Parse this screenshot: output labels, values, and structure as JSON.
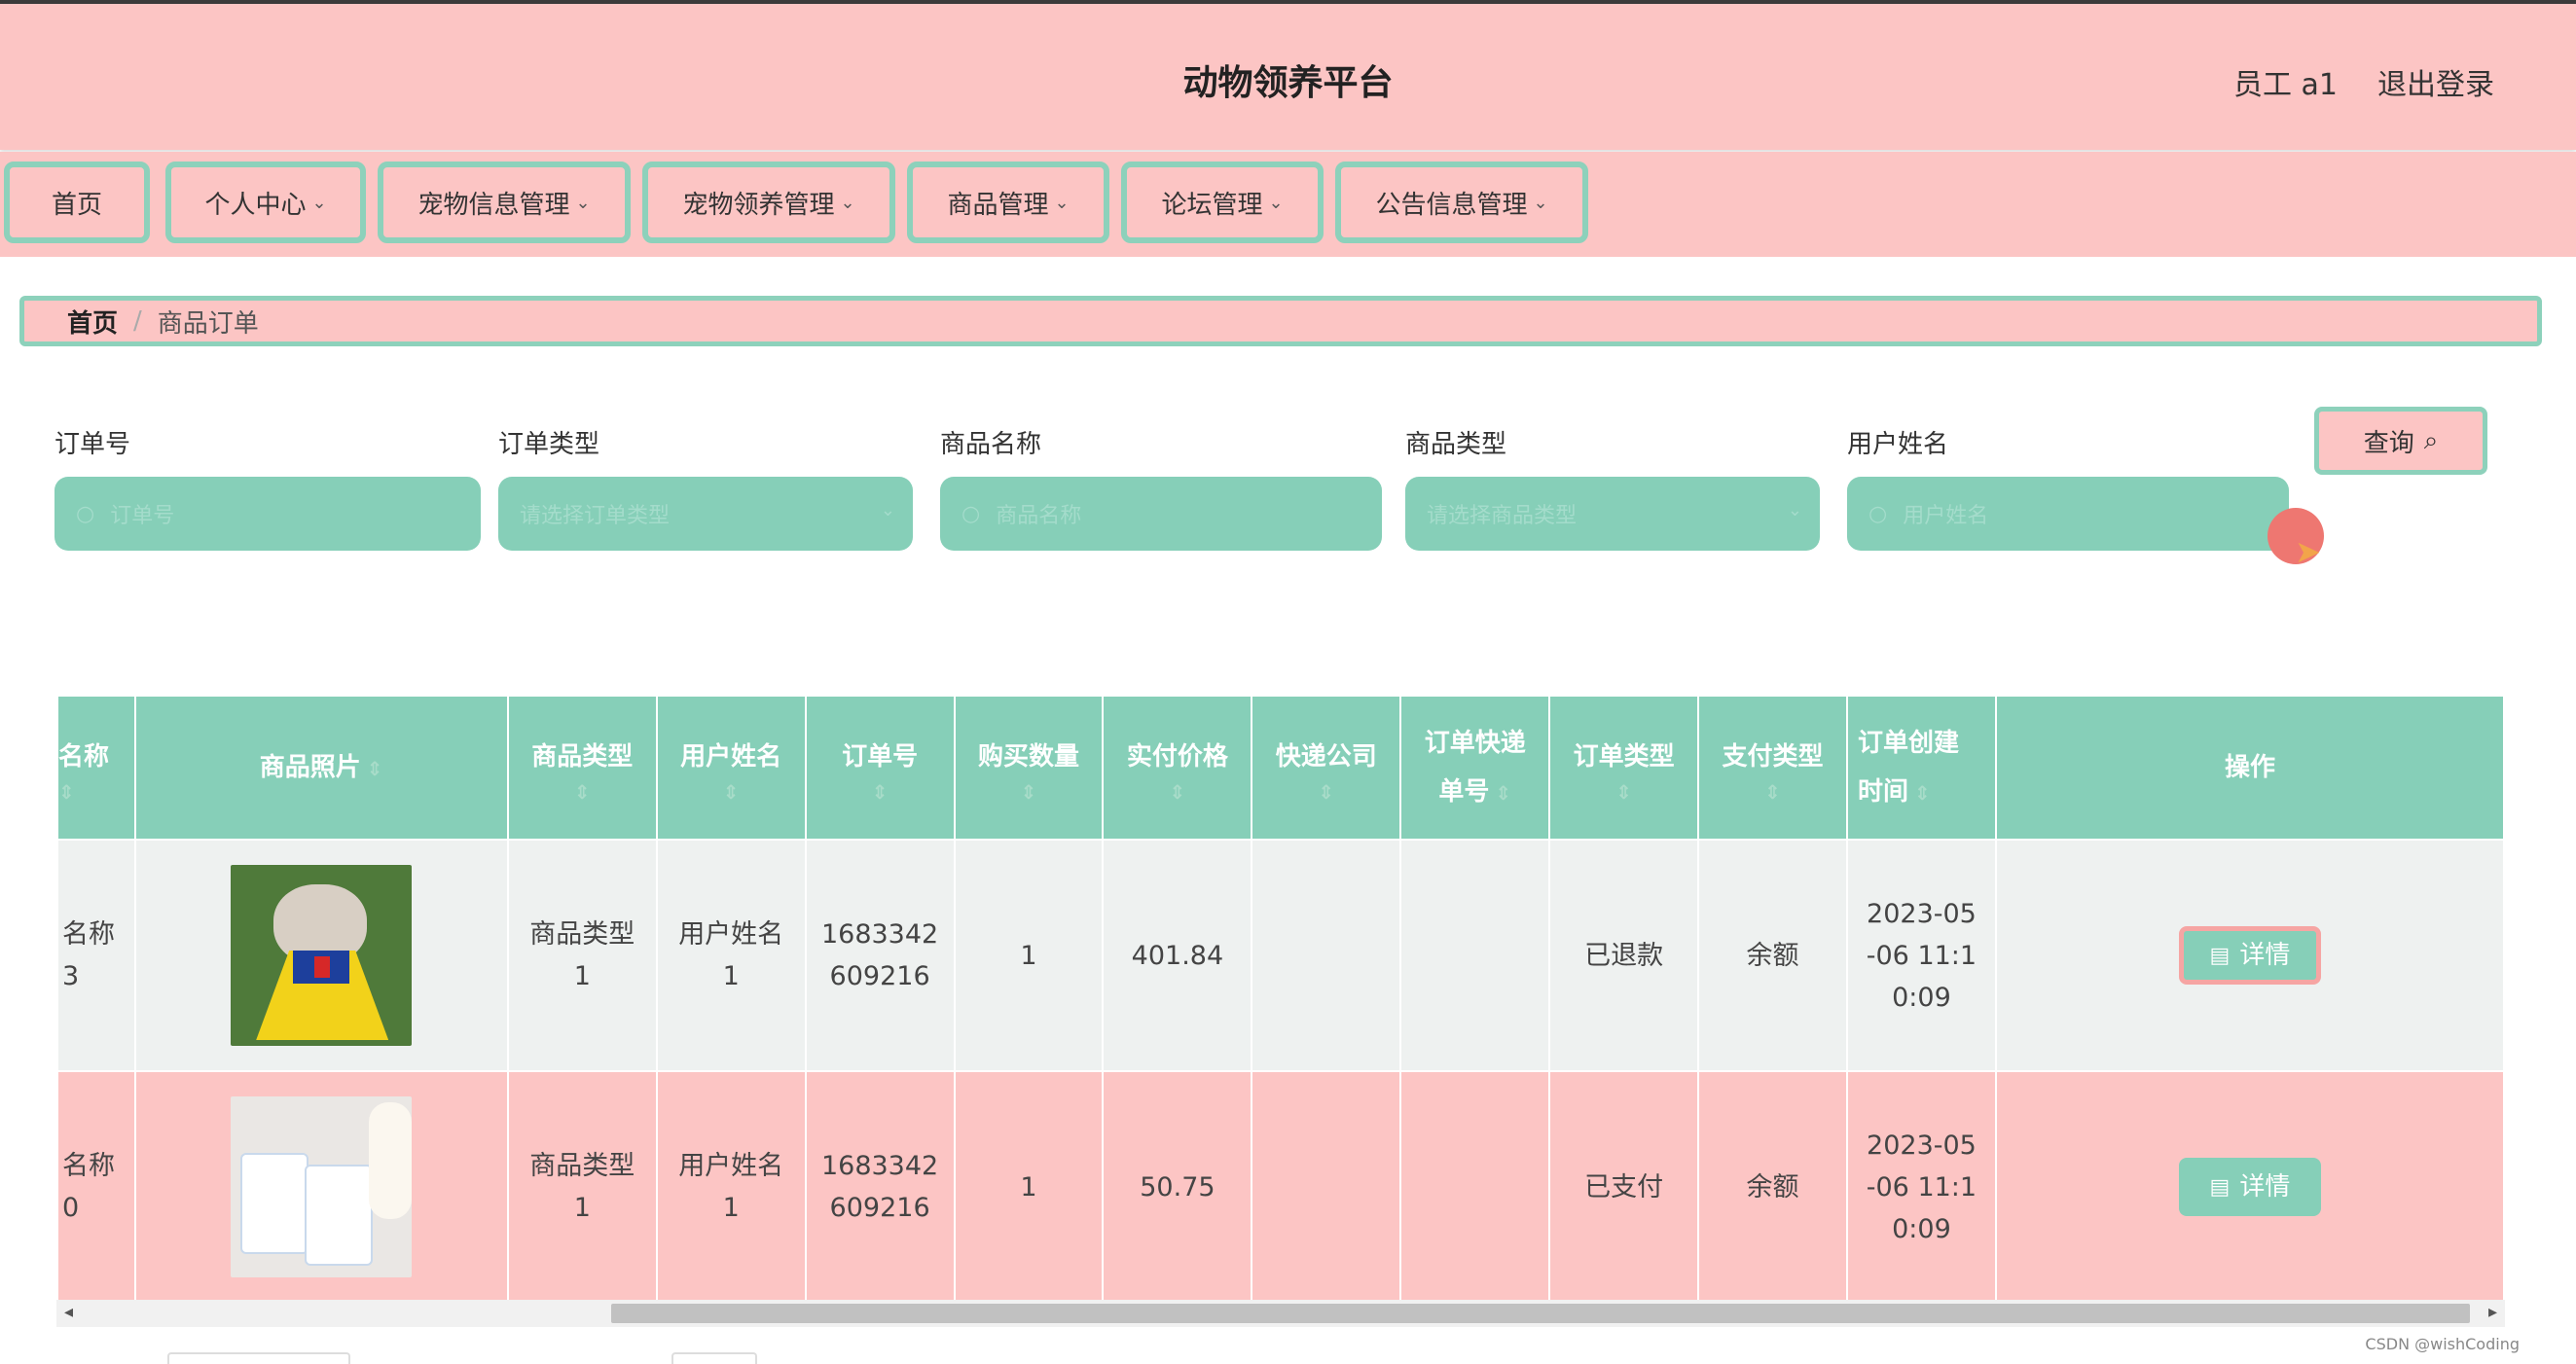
{
  "header": {
    "title": "动物领养平台",
    "user": "员工 a1",
    "logout": "退出登录"
  },
  "nav": {
    "items": [
      {
        "label": "首页",
        "has_dropdown": false
      },
      {
        "label": "个人中心",
        "has_dropdown": true
      },
      {
        "label": "宠物信息管理",
        "has_dropdown": true
      },
      {
        "label": "宠物领养管理",
        "has_dropdown": true
      },
      {
        "label": "商品管理",
        "has_dropdown": true
      },
      {
        "label": "论坛管理",
        "has_dropdown": true
      },
      {
        "label": "公告信息管理",
        "has_dropdown": true
      }
    ]
  },
  "breadcrumb": {
    "home": "首页",
    "separator": "/",
    "current": "商品订单"
  },
  "filters": {
    "order_no": {
      "label": "订单号",
      "placeholder": "订单号"
    },
    "order_type": {
      "label": "订单类型",
      "placeholder": "请选择订单类型"
    },
    "product_name": {
      "label": "商品名称",
      "placeholder": "商品名称"
    },
    "product_type": {
      "label": "商品类型",
      "placeholder": "请选择商品类型"
    },
    "user_name": {
      "label": "用户姓名",
      "placeholder": "用户姓名"
    },
    "query_label": "查询"
  },
  "table": {
    "columns": [
      {
        "line1": "名称",
        "line2": ""
      },
      {
        "line1": "商品照片",
        "line2": ""
      },
      {
        "line1": "商品类型",
        "line2": ""
      },
      {
        "line1": "用户姓名",
        "line2": ""
      },
      {
        "line1": "订单号",
        "line2": ""
      },
      {
        "line1": "购买数量",
        "line2": ""
      },
      {
        "line1": "实付价格",
        "line2": ""
      },
      {
        "line1": "快递公司",
        "line2": ""
      },
      {
        "line1": "订单快递",
        "line2": "单号"
      },
      {
        "line1": "订单类型",
        "line2": ""
      },
      {
        "line1": "支付类型",
        "line2": ""
      },
      {
        "line1": "订单创建",
        "line2": "时间"
      },
      {
        "line1": "操作",
        "line2": ""
      }
    ],
    "rows": [
      {
        "name_l1": "名称",
        "name_l2": "3",
        "type_l1": "商品类型",
        "type_l2": "1",
        "user_l1": "用户姓名",
        "user_l2": "1",
        "order_l1": "1683342",
        "order_l2": "609216",
        "qty": "1",
        "price": "401.84",
        "courier": "",
        "tracking": "",
        "order_type": "已退款",
        "pay_type": "余额",
        "created_l1": "2023-05",
        "created_l2": "-06 11:1",
        "created_l3": "0:09",
        "action": "详情"
      },
      {
        "name_l1": "名称",
        "name_l2": "0",
        "type_l1": "商品类型",
        "type_l2": "1",
        "user_l1": "用户姓名",
        "user_l2": "1",
        "order_l1": "1683342",
        "order_l2": "609216",
        "qty": "1",
        "price": "50.75",
        "courier": "",
        "tracking": "",
        "order_type": "已支付",
        "pay_type": "余额",
        "created_l1": "2023-05",
        "created_l2": "-06 11:1",
        "created_l3": "0:09",
        "action": "详情"
      }
    ]
  },
  "watermark": "CSDN @wishCoding",
  "colors": {
    "header_bg": "#fcc5c4",
    "accent": "#86cfb8",
    "row_alt": "#eef1f0"
  }
}
